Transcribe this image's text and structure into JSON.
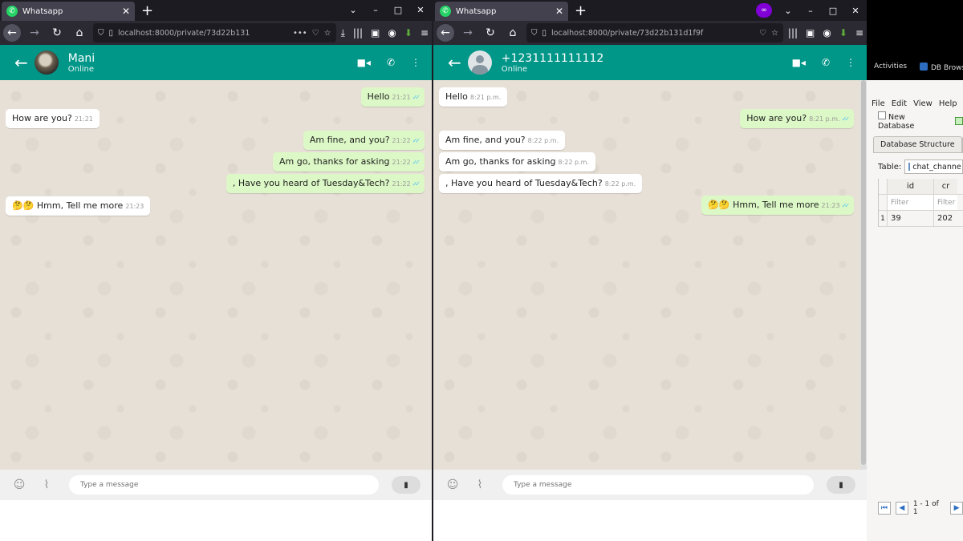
{
  "left": {
    "tab_title": "Whatsapp",
    "url": "localhost:8000/private/73d22b131",
    "contact_name": "Mani",
    "contact_status": "Online",
    "messages": [
      {
        "text": "Hello",
        "time": "21:21",
        "dir": "out"
      },
      {
        "text": "How are you?",
        "time": "21:21",
        "dir": "in"
      },
      {
        "text": "Am fine, and you?",
        "time": "21:22",
        "dir": "out"
      },
      {
        "text": "Am go, thanks for asking",
        "time": "21:22",
        "dir": "out"
      },
      {
        "text": ", Have you heard of Tuesday&Tech?",
        "time": "21:22",
        "dir": "out"
      },
      {
        "text": "🤔🤔 Hmm, Tell me more",
        "time": "21:23",
        "dir": "in"
      }
    ],
    "input_placeholder": "Type a message"
  },
  "right": {
    "tab_title": "Whatsapp",
    "url": "localhost:8000/private/73d22b131d1f9f",
    "contact_name": "+1231111111112",
    "contact_status": "Online",
    "messages": [
      {
        "text": "Hello",
        "time": "8:21 p.m.",
        "dir": "in"
      },
      {
        "text": "How are you?",
        "time": "8:21 p.m.",
        "dir": "out"
      },
      {
        "text": "Am fine, and you?",
        "time": "8:22 p.m.",
        "dir": "in"
      },
      {
        "text": "Am go, thanks for asking",
        "time": "8:22 p.m.",
        "dir": "in"
      },
      {
        "text": ", Have you heard of Tuesday&Tech?",
        "time": "8:22 p.m.",
        "dir": "in"
      },
      {
        "text": "🤔🤔 Hmm, Tell me more",
        "time": "21:23",
        "dir": "out"
      }
    ],
    "input_placeholder": "Type a message"
  },
  "icons": {
    "back": "arrow-left-icon",
    "video": "video-camera-icon",
    "call": "phone-icon",
    "menu": "kebab-menu-icon",
    "emoji": "emoji-icon",
    "attach": "paperclip-icon",
    "mic": "microphone-icon"
  },
  "colors": {
    "header": "#009688",
    "outgoing": "#dcf8c6",
    "incoming": "#ffffff",
    "ticks": "#4fc3f7"
  },
  "db": {
    "activities": "Activities",
    "app_name": "DB Brows",
    "menu": [
      "File",
      "Edit",
      "View",
      "Help"
    ],
    "new_database": "New Database",
    "tab": "Database Structure",
    "table_label": "Table:",
    "table_name": "chat_channe",
    "columns": [
      "id",
      "cr"
    ],
    "filter": "Filter",
    "row_index": "1",
    "row_values": [
      "39",
      "202"
    ],
    "pager_text": "1 - 1 of 1"
  }
}
